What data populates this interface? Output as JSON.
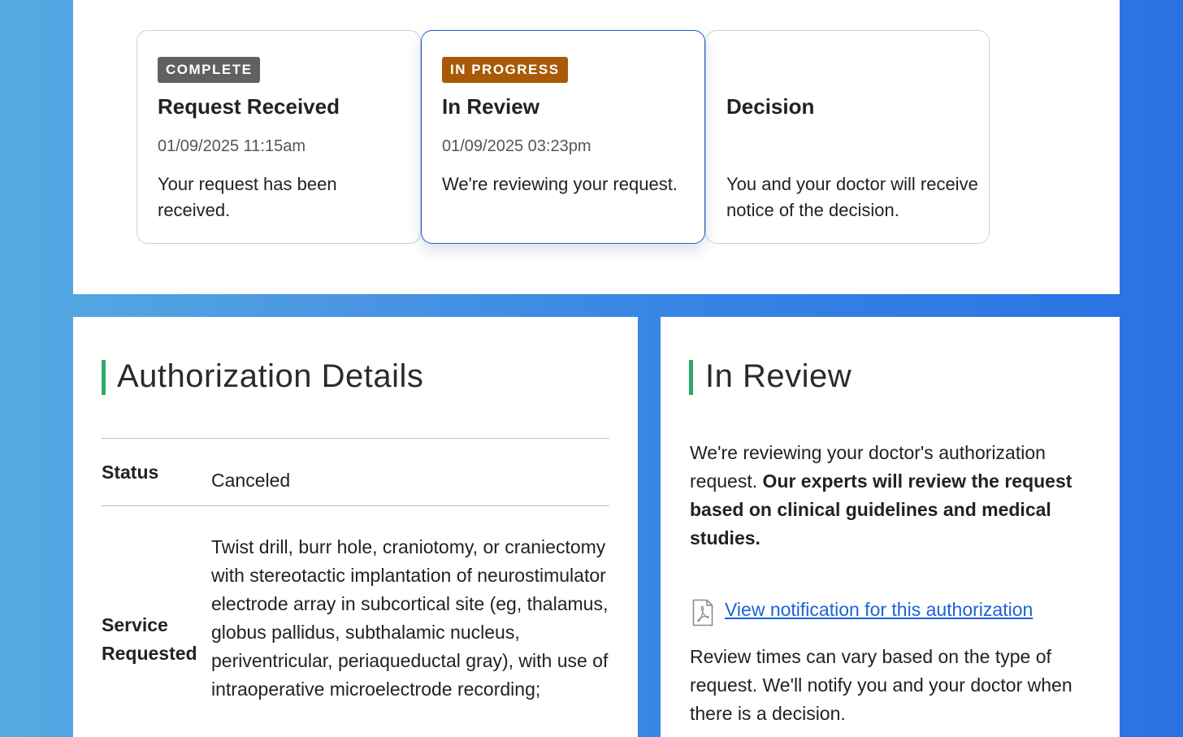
{
  "steps": [
    {
      "badge": "COMPLETE",
      "title": "Request Received",
      "time": "01/09/2025 11:15am",
      "description": "Your request has been received.",
      "state": "complete"
    },
    {
      "badge": "IN PROGRESS",
      "title": "In Review",
      "time": "01/09/2025 03:23pm",
      "description": "We're reviewing your request.",
      "state": "in-progress"
    },
    {
      "badge": "",
      "title": "Decision",
      "time": "",
      "description": "You and your doctor will receive notice of the decision.",
      "state": "pending"
    }
  ],
  "details": {
    "heading": "Authorization Details",
    "status_label": "Status",
    "status_value": "Canceled",
    "service_label_line1": "Service",
    "service_label_line2": "Requested",
    "service_value": "Twist drill, burr hole, craniotomy, or craniectomy with stereotactic implantation of neurostimulator electrode array in subcortical site (eg, thalamus, globus pallidus, subthalamic nucleus, periventricular, periaqueductal gray), with use of intraoperative microelectrode recording;"
  },
  "review": {
    "heading": "In Review",
    "intro": "We're reviewing your doctor's authorization request.",
    "intro_bold": "Our experts will review the request based on clinical guidelines and medical studies.",
    "link_icon": "pdf-icon",
    "link_text": "View notification for this authorization",
    "footer": "Review times can vary based on the type of request. We'll notify you and your doctor when there is a decision."
  },
  "colors": {
    "complete_badge": "#616161",
    "in_progress_badge": "#a85a07",
    "active_border": "#1a5fcf",
    "heading_accent": "#2fa86b",
    "link": "#1a63d6"
  }
}
